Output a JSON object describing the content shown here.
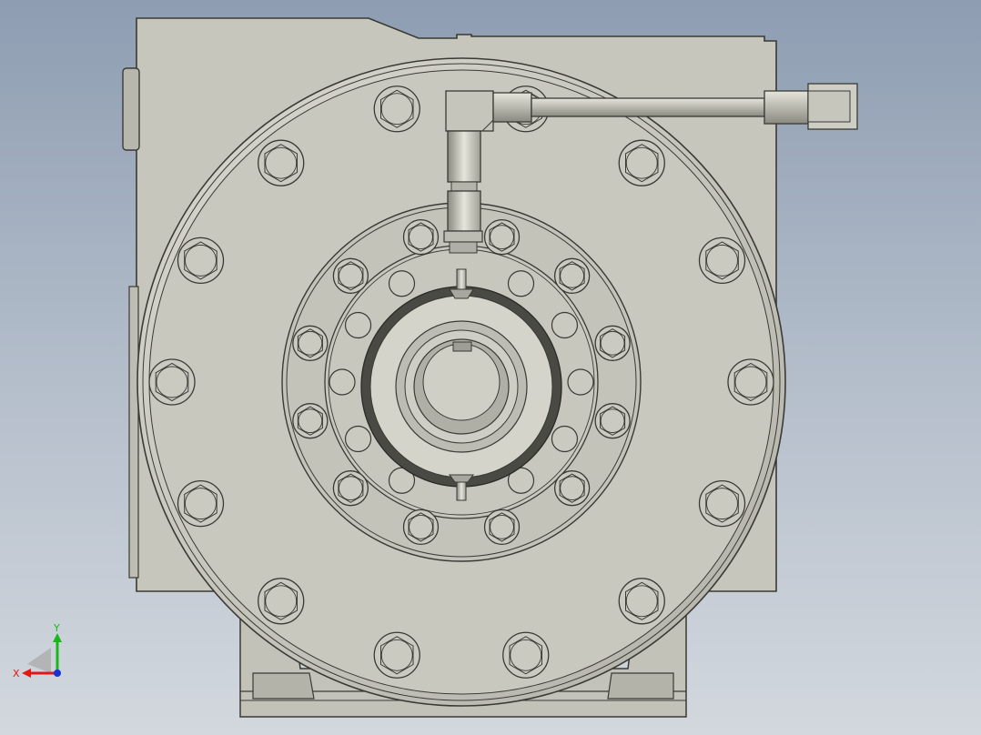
{
  "viewport": {
    "background_top": "#8e9db2",
    "background_bottom": "#d3d8de"
  },
  "model": {
    "body_color": "#c7c6bd",
    "edge_color": "#3a3a34",
    "shade_color": "#9f9e95",
    "flange_bolt_count": 14,
    "inner_bolt_count": 12
  },
  "triad": {
    "x_label": "X",
    "y_label": "Y",
    "x_color": "#e01818",
    "y_color": "#18b818",
    "z_color": "#1830d8"
  }
}
